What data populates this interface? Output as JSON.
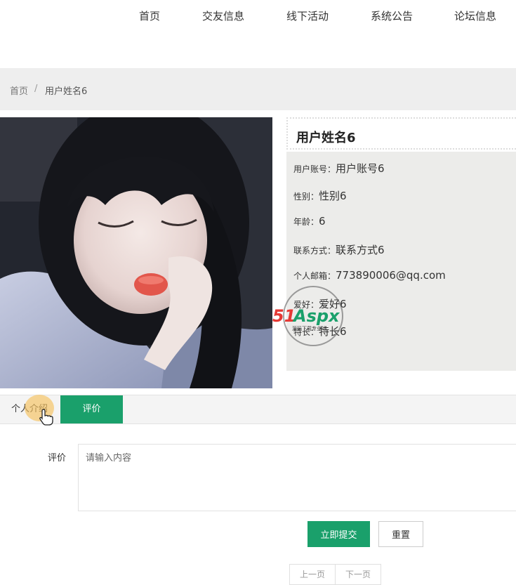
{
  "nav": {
    "items": [
      "首页",
      "交友信息",
      "线下活动",
      "系统公告",
      "论坛信息"
    ]
  },
  "breadcrumb": {
    "home": "首页",
    "separator": "/",
    "current": "用户姓名6"
  },
  "profile": {
    "name": "用户姓名6",
    "fields": [
      {
        "label": "用户账号：",
        "value": "用户账号6"
      },
      {
        "label": "性别：",
        "value": "性别6"
      },
      {
        "label": "年龄：",
        "value": "6"
      },
      {
        "label": "联系方式：",
        "value": "联系方式6"
      },
      {
        "label": "个人邮箱：",
        "value": "773890006@qq.com"
      },
      {
        "label": "爱好：",
        "value": "爱好6"
      },
      {
        "label": "特长：",
        "value": "特长6"
      }
    ]
  },
  "watermark": {
    "text": "51Aspx",
    "subtext": "源码下载专业站"
  },
  "tabs": {
    "intro": "个人介绍",
    "review": "评价"
  },
  "review_form": {
    "label": "评价",
    "placeholder": "请输入内容",
    "submit": "立即提交",
    "reset": "重置"
  },
  "pager": {
    "prev": "上一页",
    "next": "下一页"
  },
  "colors": {
    "accent_green": "#1aa06b",
    "watermark_red": "#e53935",
    "watermark_green": "#1aa06b"
  },
  "icons": [
    "hand-pointer-icon"
  ]
}
